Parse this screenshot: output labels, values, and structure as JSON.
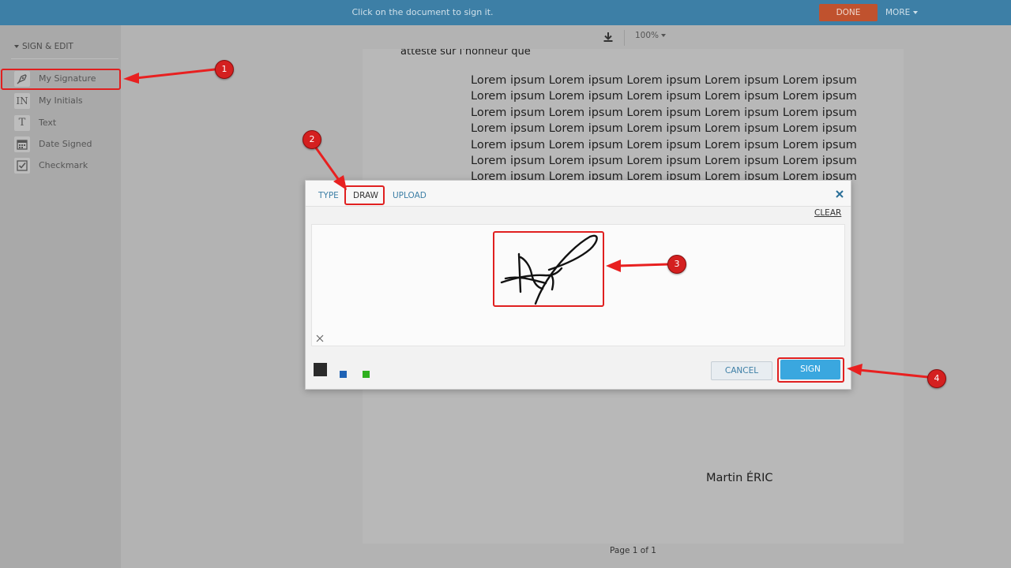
{
  "topbar": {
    "hint": "Click on the document to sign it.",
    "done_label": "DONE",
    "more_label": "MORE"
  },
  "sidebar": {
    "section_title": "SIGN & EDIT",
    "items": [
      {
        "label": "My Signature",
        "icon": "pen-nib-icon"
      },
      {
        "label": "My Initials",
        "icon_text": "IN"
      },
      {
        "label": "Text",
        "icon_text": "T"
      },
      {
        "label": "Date Signed",
        "icon": "calendar-icon"
      },
      {
        "label": "Checkmark",
        "icon": "checkbox-icon"
      }
    ]
  },
  "doc_toolbar": {
    "zoom": "100%"
  },
  "document": {
    "intro": "atteste sur l'honneur que",
    "lines": [
      "Lorem ipsum Lorem ipsum Lorem ipsum Lorem ipsum Lorem ipsum",
      "Lorem ipsum Lorem ipsum Lorem ipsum Lorem ipsum Lorem ipsum",
      "Lorem ipsum Lorem ipsum Lorem ipsum Lorem ipsum Lorem ipsum",
      "Lorem ipsum Lorem ipsum Lorem ipsum Lorem ipsum Lorem ipsum",
      "Lorem ipsum Lorem ipsum Lorem ipsum Lorem ipsum Lorem ipsum",
      "Lorem ipsum Lorem ipsum Lorem ipsum Lorem ipsum Lorem ipsum",
      "Lorem ipsum Lorem ipsum Lorem ipsum Lorem ipsum Lorem ipsum"
    ],
    "signer_name": "Martin ÉRIC",
    "page_indicator": "Page 1 of 1"
  },
  "modal": {
    "tabs": [
      "TYPE",
      "DRAW",
      "UPLOAD"
    ],
    "active_tab": "DRAW",
    "clear_label": "CLEAR",
    "cancel_label": "CANCEL",
    "sign_label": "SIGN",
    "colors": [
      "#2b2b2b",
      "#1f63b5",
      "#2fb01e"
    ]
  },
  "annotations": {
    "badges": [
      "1",
      "2",
      "3",
      "4"
    ],
    "color": "#e02020"
  }
}
